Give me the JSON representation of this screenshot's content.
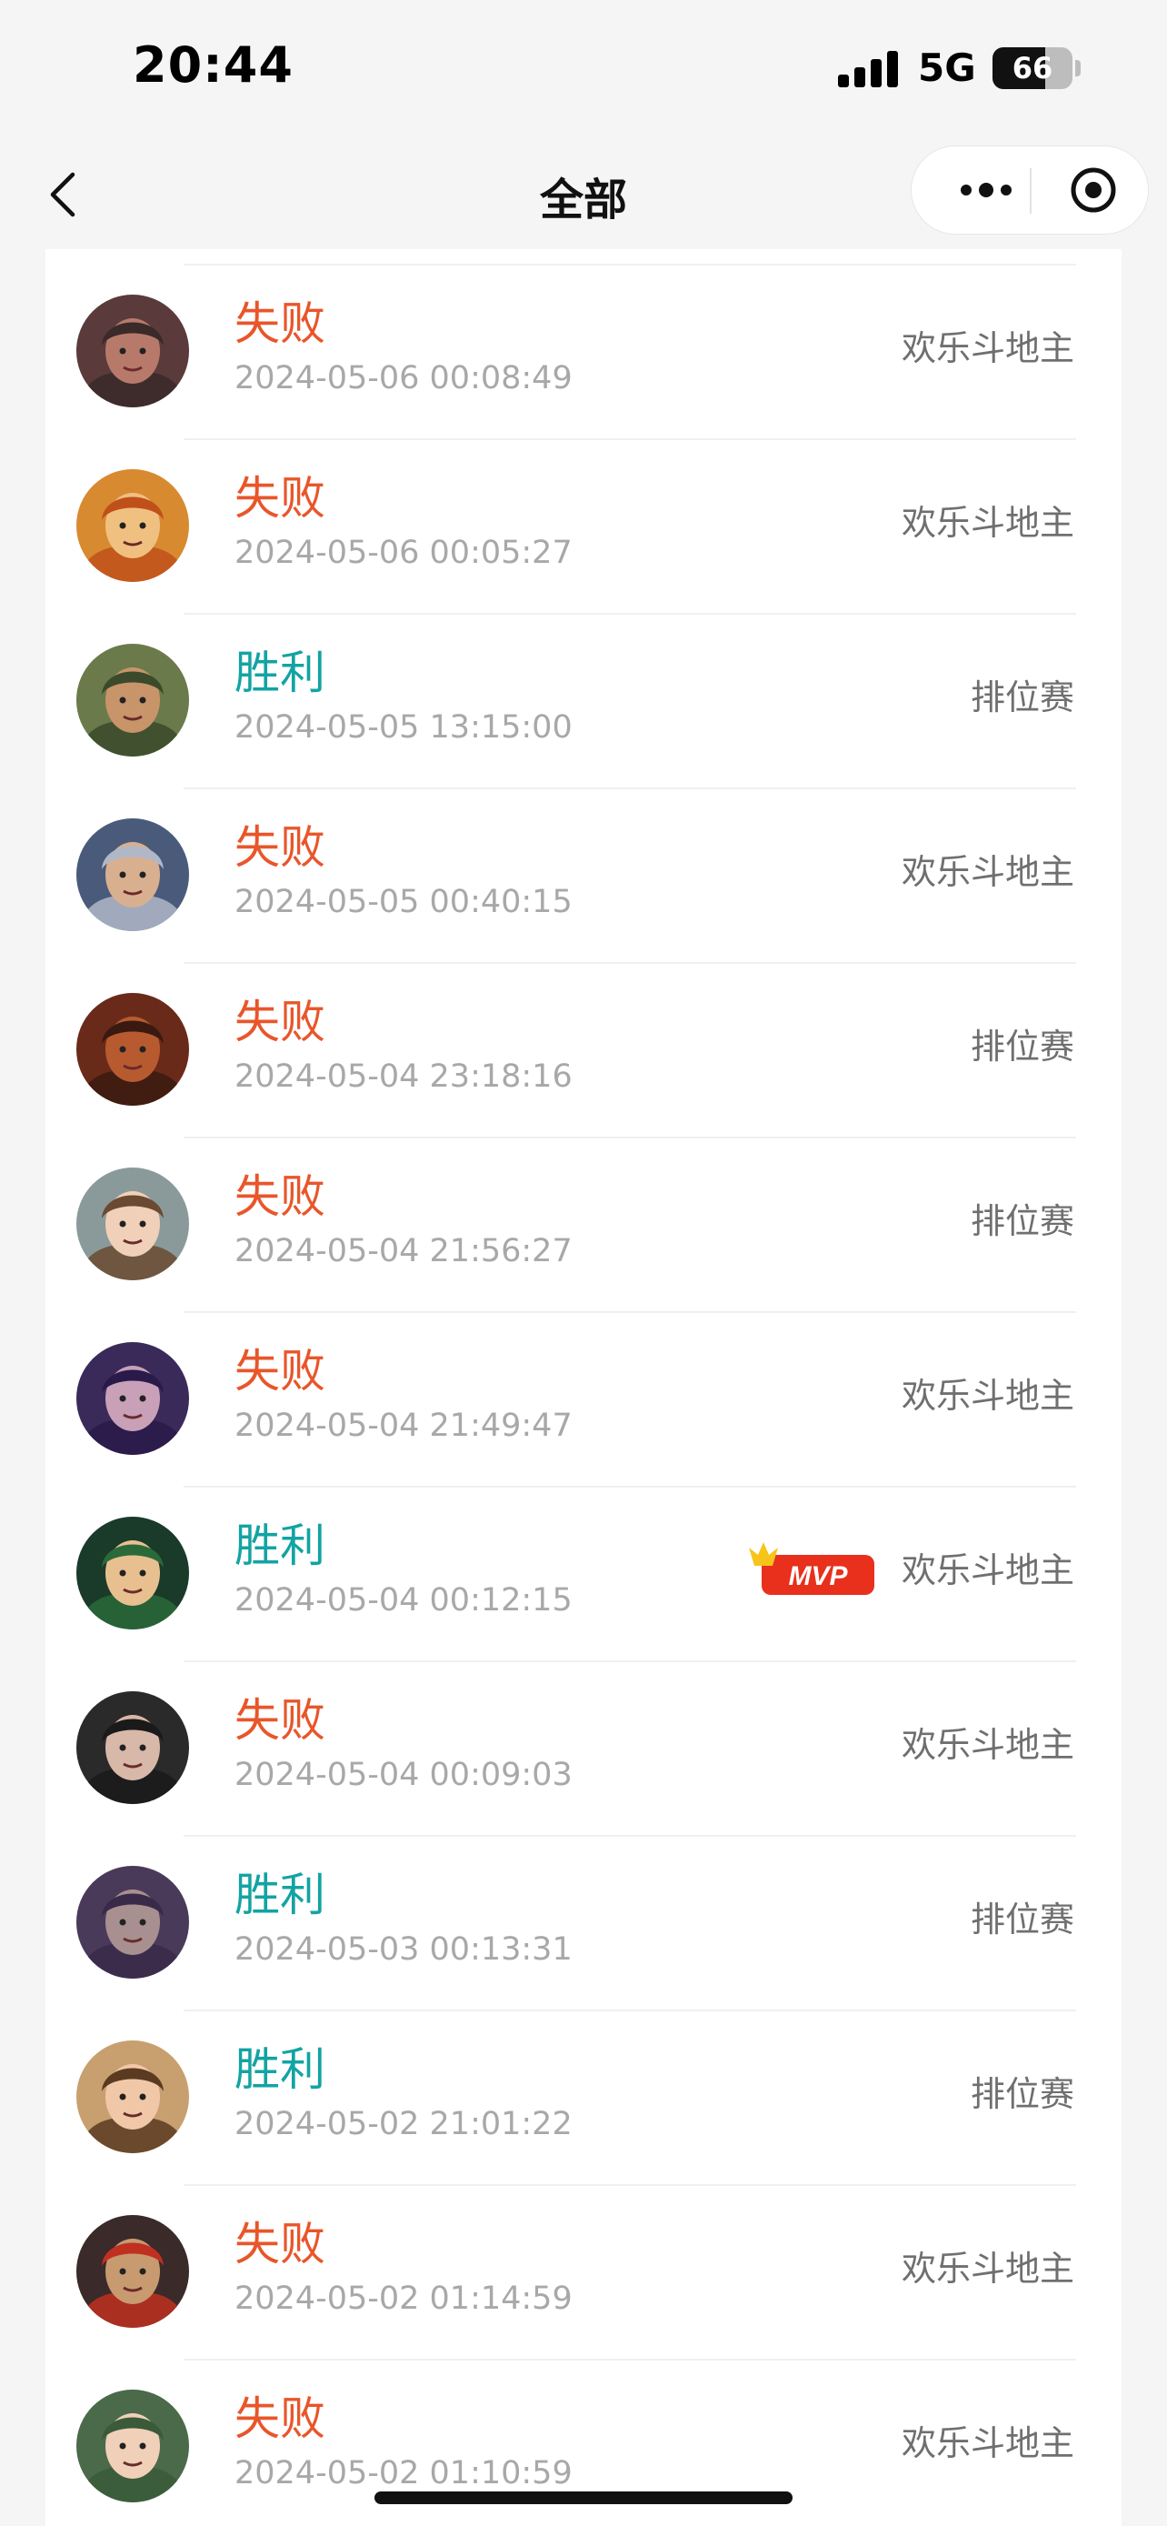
{
  "status_bar": {
    "time": "20:44",
    "network": "5G",
    "battery": "66",
    "battery_level": 0.66
  },
  "navbar": {
    "title": "全部",
    "more_icon": "more-dots-icon",
    "close_icon": "target-circle-icon"
  },
  "colors": {
    "lose": "#e8562a",
    "win": "#13a3a3"
  },
  "records": [
    {
      "result": "失败",
      "outcome": "lose",
      "time": "2024-05-06 00:08:49",
      "mode": "欢乐斗地主",
      "mvp": false,
      "avatar": {
        "skin": "#b77a6a",
        "hair": "#3a2a2a",
        "bg": "#5a3a3a"
      }
    },
    {
      "result": "失败",
      "outcome": "lose",
      "time": "2024-05-06 00:05:27",
      "mode": "欢乐斗地主",
      "mvp": false,
      "avatar": {
        "skin": "#f0c080",
        "hair": "#c0501a",
        "bg": "#d88a30"
      }
    },
    {
      "result": "胜利",
      "outcome": "win",
      "time": "2024-05-05 13:15:00",
      "mode": "排位赛",
      "mvp": false,
      "avatar": {
        "skin": "#c8946a",
        "hair": "#3a4a2a",
        "bg": "#6a7a4a"
      }
    },
    {
      "result": "失败",
      "outcome": "lose",
      "time": "2024-05-05 00:40:15",
      "mode": "欢乐斗地主",
      "mvp": false,
      "avatar": {
        "skin": "#d8b090",
        "hair": "#b0b8c8",
        "bg": "#4a5a7a"
      }
    },
    {
      "result": "失败",
      "outcome": "lose",
      "time": "2024-05-04 23:18:16",
      "mode": "排位赛",
      "mvp": false,
      "avatar": {
        "skin": "#b85a30",
        "hair": "#3a1a10",
        "bg": "#6a2a1a"
      }
    },
    {
      "result": "失败",
      "outcome": "lose",
      "time": "2024-05-04 21:56:27",
      "mode": "排位赛",
      "mvp": false,
      "avatar": {
        "skin": "#f0d0b8",
        "hair": "#6a4a30",
        "bg": "#8a9a9a"
      }
    },
    {
      "result": "失败",
      "outcome": "lose",
      "time": "2024-05-04 21:49:47",
      "mode": "欢乐斗地主",
      "mvp": false,
      "avatar": {
        "skin": "#c8a0b8",
        "hair": "#2a1a4a",
        "bg": "#3a2a5a"
      }
    },
    {
      "result": "胜利",
      "outcome": "win",
      "time": "2024-05-04 00:12:15",
      "mode": "欢乐斗地主",
      "mvp": true,
      "avatar": {
        "skin": "#e8c090",
        "hair": "#2a6a3a",
        "bg": "#1a3a2a"
      }
    },
    {
      "result": "失败",
      "outcome": "lose",
      "time": "2024-05-04 00:09:03",
      "mode": "欢乐斗地主",
      "mvp": false,
      "avatar": {
        "skin": "#d8b8a8",
        "hair": "#1a1a1a",
        "bg": "#2a2a2a"
      }
    },
    {
      "result": "胜利",
      "outcome": "win",
      "time": "2024-05-03 00:13:31",
      "mode": "排位赛",
      "mvp": false,
      "avatar": {
        "skin": "#a89090",
        "hair": "#3a2a4a",
        "bg": "#4a3a5a"
      }
    },
    {
      "result": "胜利",
      "outcome": "win",
      "time": "2024-05-02 21:01:22",
      "mode": "排位赛",
      "mvp": false,
      "avatar": {
        "skin": "#f0c8a8",
        "hair": "#5a3a20",
        "bg": "#c8a070"
      }
    },
    {
      "result": "失败",
      "outcome": "lose",
      "time": "2024-05-02 01:14:59",
      "mode": "欢乐斗地主",
      "mvp": false,
      "avatar": {
        "skin": "#c89a70",
        "hair": "#c03020",
        "bg": "#3a2a2a"
      }
    },
    {
      "result": "失败",
      "outcome": "lose",
      "time": "2024-05-02 01:10:59",
      "mode": "欢乐斗地主",
      "mvp": false,
      "avatar": {
        "skin": "#f0d0b8",
        "hair": "#3a5a3a",
        "bg": "#4a6a4a"
      }
    }
  ],
  "mvp_label": "MVP"
}
